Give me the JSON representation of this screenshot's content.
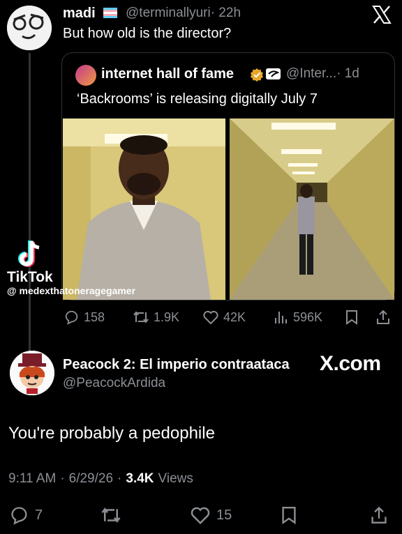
{
  "reply_tweet": {
    "display_name": "madi",
    "handle": "@terminallyuri",
    "time": "· 22h",
    "text": "But how old is the director?"
  },
  "quoted_tweet": {
    "display_name": "internet hall of fame",
    "handle": "@Inter...",
    "time": "· 1d",
    "text": "‘Backrooms’ is releasing digitally July 7"
  },
  "tiktok": {
    "label": "TikTok",
    "handle": "@ medexthatoneragegamer"
  },
  "actions_top": {
    "replies": "158",
    "reposts": "1.9K",
    "likes": "42K",
    "views": "596K"
  },
  "main_tweet": {
    "display_name": "Peacock 2: El imperio contraataca",
    "handle": "@PeacockArdida",
    "watermark": "X.com",
    "text": "You're probably a pedophile",
    "time": "9:11 AM",
    "date": "6/29/26",
    "views_count": "3.4K",
    "views_label": "Views"
  },
  "actions_bottom": {
    "replies": "7",
    "likes": "15"
  },
  "colors": {
    "background": "#000000",
    "muted": "#8b8f94",
    "verified": "#e8a72b"
  }
}
